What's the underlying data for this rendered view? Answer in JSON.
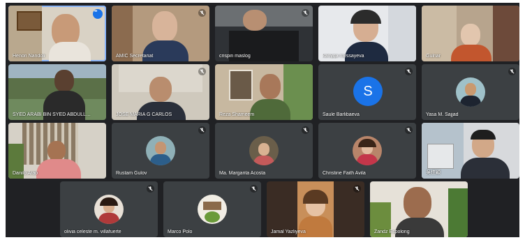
{
  "meeting": {
    "participants": [
      {
        "name": "Henon Nandoli",
        "state": "video",
        "active": true
      },
      {
        "name": "AMIC Secretariat",
        "state": "video"
      },
      {
        "name": "crispin maslog",
        "state": "video"
      },
      {
        "name": "karlyga myssayeva",
        "state": "video"
      },
      {
        "name": "Gulnar",
        "state": "video"
      },
      {
        "name": "SYED ARABI BIN SYED ABDULLA…",
        "state": "video"
      },
      {
        "name": "JOSE MARIA G CARLOS",
        "state": "video"
      },
      {
        "name": "Reza Shameem",
        "state": "video"
      },
      {
        "name": "Saule Barlibaeva",
        "state": "letter",
        "letter": "S"
      },
      {
        "name": "Yasa M. Sajjad",
        "state": "photo"
      },
      {
        "name": "Danilo Arao",
        "state": "video"
      },
      {
        "name": "Rustam Gulov",
        "state": "photo"
      },
      {
        "name": "Ma. Margarita Acosta",
        "state": "photo"
      },
      {
        "name": "Christine Faith Avila",
        "state": "photo"
      },
      {
        "name": "吳佳穎",
        "state": "video"
      },
      {
        "name": "olivia celeste m. villafuerte",
        "state": "photo"
      },
      {
        "name": "Marco Polo",
        "state": "photo"
      },
      {
        "name": "Jamal Yazliyeva",
        "state": "video"
      },
      {
        "name": "Zandz Espolong",
        "state": "video"
      }
    ]
  },
  "colors": {
    "background": "#202124",
    "tile": "#3c4043",
    "accent": "#1a73e8"
  }
}
